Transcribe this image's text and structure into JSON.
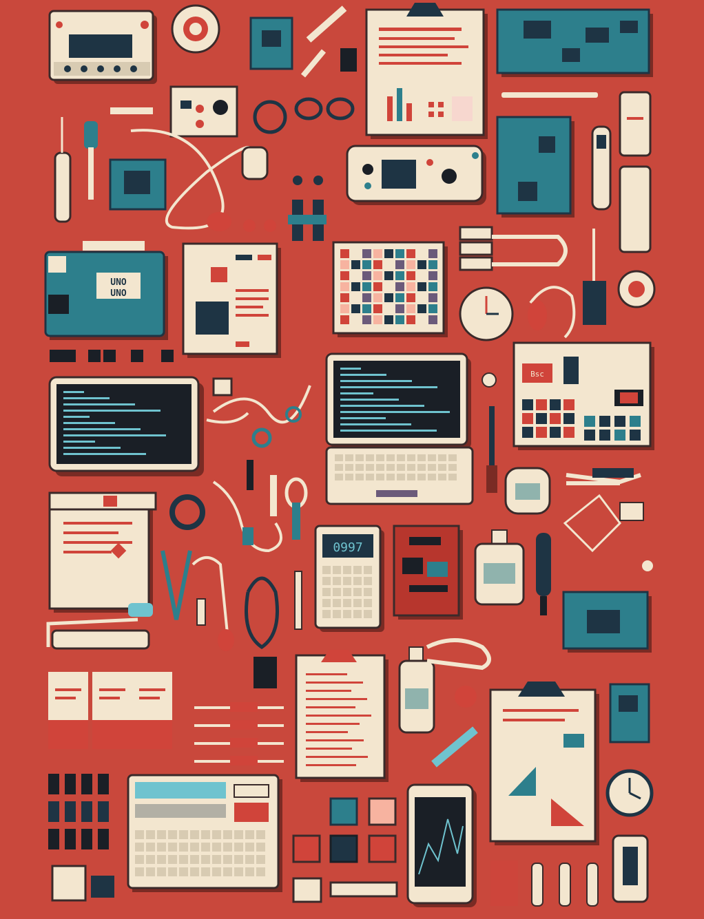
{
  "scene": {
    "style": "pixel-art flat lay",
    "colors": {
      "background": "#c9483c",
      "cream": "#f3e6cf",
      "teal": "#2d7f8c",
      "navy": "#1e3444",
      "red": "#d0443a",
      "dark": "#1a1f26",
      "screen_text": "#6fc3cf"
    }
  },
  "labels": {
    "board_logo": "UNO",
    "board_logo_line2": "UNO",
    "calculator_display": "0997",
    "device_tag": "Bsc"
  },
  "items": [
    "signal-generator",
    "tape-roll",
    "microchip",
    "soldering-tool",
    "clipboard-report",
    "circuit-board",
    "control-box",
    "wire-bundle",
    "cable",
    "soldering-iron",
    "chip-module",
    "earbuds",
    "knobs",
    "game-controller",
    "circuit-board-2",
    "marker",
    "paper-roll",
    "development-board",
    "document",
    "color-palette-board",
    "cable-clamp",
    "stopwatch",
    "synth-panel",
    "terminal-monitor",
    "laptop",
    "jar",
    "pliers",
    "notebook",
    "wire-spool",
    "probes",
    "calculator",
    "pcb-red",
    "bottle",
    "multimeter-probe",
    "microcontroller-board",
    "reagent-bottles",
    "tweezers",
    "breadboard-cables",
    "clipboard-checklist",
    "bottle-2",
    "clipboard-chart",
    "small-board",
    "wall-clock",
    "keyboard-terminal",
    "sticky-notes",
    "tablet",
    "batteries",
    "usb-drive"
  ]
}
